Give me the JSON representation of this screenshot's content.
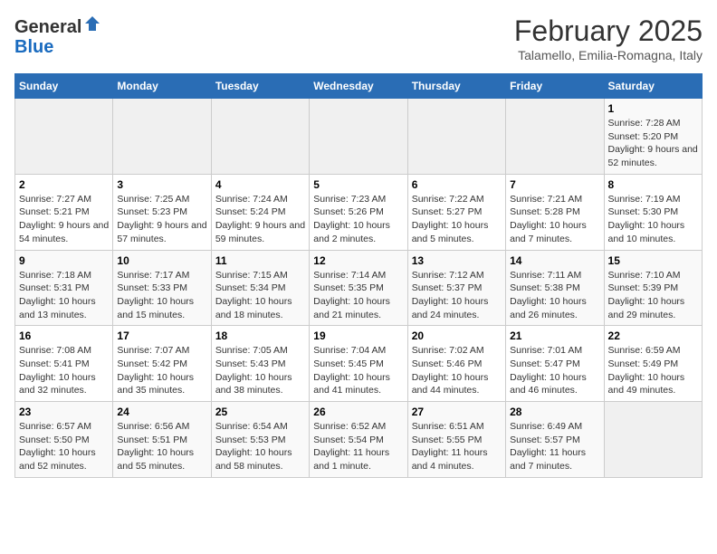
{
  "header": {
    "logo_line1": "General",
    "logo_line2": "Blue",
    "month": "February 2025",
    "location": "Talamello, Emilia-Romagna, Italy"
  },
  "weekdays": [
    "Sunday",
    "Monday",
    "Tuesday",
    "Wednesday",
    "Thursday",
    "Friday",
    "Saturday"
  ],
  "weeks": [
    [
      {
        "day": "",
        "info": ""
      },
      {
        "day": "",
        "info": ""
      },
      {
        "day": "",
        "info": ""
      },
      {
        "day": "",
        "info": ""
      },
      {
        "day": "",
        "info": ""
      },
      {
        "day": "",
        "info": ""
      },
      {
        "day": "1",
        "info": "Sunrise: 7:28 AM\nSunset: 5:20 PM\nDaylight: 9 hours and 52 minutes."
      }
    ],
    [
      {
        "day": "2",
        "info": "Sunrise: 7:27 AM\nSunset: 5:21 PM\nDaylight: 9 hours and 54 minutes."
      },
      {
        "day": "3",
        "info": "Sunrise: 7:25 AM\nSunset: 5:23 PM\nDaylight: 9 hours and 57 minutes."
      },
      {
        "day": "4",
        "info": "Sunrise: 7:24 AM\nSunset: 5:24 PM\nDaylight: 9 hours and 59 minutes."
      },
      {
        "day": "5",
        "info": "Sunrise: 7:23 AM\nSunset: 5:26 PM\nDaylight: 10 hours and 2 minutes."
      },
      {
        "day": "6",
        "info": "Sunrise: 7:22 AM\nSunset: 5:27 PM\nDaylight: 10 hours and 5 minutes."
      },
      {
        "day": "7",
        "info": "Sunrise: 7:21 AM\nSunset: 5:28 PM\nDaylight: 10 hours and 7 minutes."
      },
      {
        "day": "8",
        "info": "Sunrise: 7:19 AM\nSunset: 5:30 PM\nDaylight: 10 hours and 10 minutes."
      }
    ],
    [
      {
        "day": "9",
        "info": "Sunrise: 7:18 AM\nSunset: 5:31 PM\nDaylight: 10 hours and 13 minutes."
      },
      {
        "day": "10",
        "info": "Sunrise: 7:17 AM\nSunset: 5:33 PM\nDaylight: 10 hours and 15 minutes."
      },
      {
        "day": "11",
        "info": "Sunrise: 7:15 AM\nSunset: 5:34 PM\nDaylight: 10 hours and 18 minutes."
      },
      {
        "day": "12",
        "info": "Sunrise: 7:14 AM\nSunset: 5:35 PM\nDaylight: 10 hours and 21 minutes."
      },
      {
        "day": "13",
        "info": "Sunrise: 7:12 AM\nSunset: 5:37 PM\nDaylight: 10 hours and 24 minutes."
      },
      {
        "day": "14",
        "info": "Sunrise: 7:11 AM\nSunset: 5:38 PM\nDaylight: 10 hours and 26 minutes."
      },
      {
        "day": "15",
        "info": "Sunrise: 7:10 AM\nSunset: 5:39 PM\nDaylight: 10 hours and 29 minutes."
      }
    ],
    [
      {
        "day": "16",
        "info": "Sunrise: 7:08 AM\nSunset: 5:41 PM\nDaylight: 10 hours and 32 minutes."
      },
      {
        "day": "17",
        "info": "Sunrise: 7:07 AM\nSunset: 5:42 PM\nDaylight: 10 hours and 35 minutes."
      },
      {
        "day": "18",
        "info": "Sunrise: 7:05 AM\nSunset: 5:43 PM\nDaylight: 10 hours and 38 minutes."
      },
      {
        "day": "19",
        "info": "Sunrise: 7:04 AM\nSunset: 5:45 PM\nDaylight: 10 hours and 41 minutes."
      },
      {
        "day": "20",
        "info": "Sunrise: 7:02 AM\nSunset: 5:46 PM\nDaylight: 10 hours and 44 minutes."
      },
      {
        "day": "21",
        "info": "Sunrise: 7:01 AM\nSunset: 5:47 PM\nDaylight: 10 hours and 46 minutes."
      },
      {
        "day": "22",
        "info": "Sunrise: 6:59 AM\nSunset: 5:49 PM\nDaylight: 10 hours and 49 minutes."
      }
    ],
    [
      {
        "day": "23",
        "info": "Sunrise: 6:57 AM\nSunset: 5:50 PM\nDaylight: 10 hours and 52 minutes."
      },
      {
        "day": "24",
        "info": "Sunrise: 6:56 AM\nSunset: 5:51 PM\nDaylight: 10 hours and 55 minutes."
      },
      {
        "day": "25",
        "info": "Sunrise: 6:54 AM\nSunset: 5:53 PM\nDaylight: 10 hours and 58 minutes."
      },
      {
        "day": "26",
        "info": "Sunrise: 6:52 AM\nSunset: 5:54 PM\nDaylight: 11 hours and 1 minute."
      },
      {
        "day": "27",
        "info": "Sunrise: 6:51 AM\nSunset: 5:55 PM\nDaylight: 11 hours and 4 minutes."
      },
      {
        "day": "28",
        "info": "Sunrise: 6:49 AM\nSunset: 5:57 PM\nDaylight: 11 hours and 7 minutes."
      },
      {
        "day": "",
        "info": ""
      }
    ]
  ]
}
